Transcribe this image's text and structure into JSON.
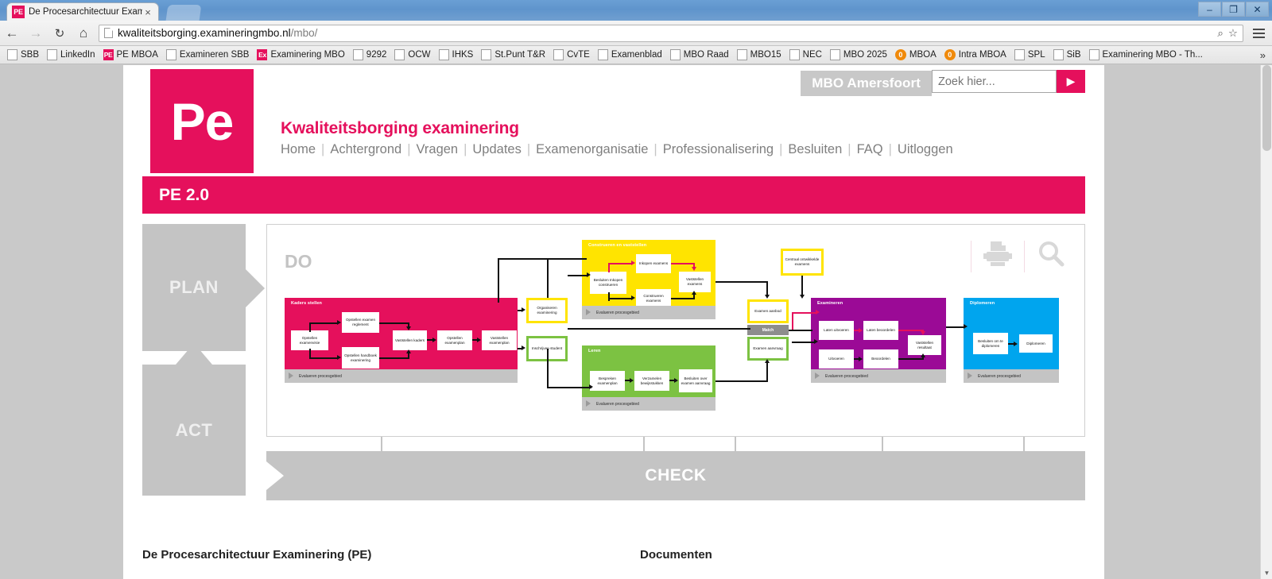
{
  "browser": {
    "tab": {
      "title": "De Procesarchitectuur Exami",
      "favicon_label": "PE",
      "close_label": "×"
    },
    "new_tab_label": "",
    "window_controls": {
      "minimize": "–",
      "maximize": "❐",
      "close": "✕"
    },
    "nav": {
      "back": "←",
      "forward": "→",
      "reload": "↻",
      "home": "⌂"
    },
    "omnibox": {
      "url_host": "kwaliteitsborging.examineringmbo.nl",
      "url_path": "/mbo/",
      "zoom_icon": "⌕",
      "star_icon": "☆"
    },
    "bookmarks": [
      {
        "label": "SBB",
        "icon": "page-icon"
      },
      {
        "label": "LinkedIn",
        "icon": "page-icon"
      },
      {
        "label": "PE MBOA",
        "icon": "pe-icon",
        "icon_text": "PE"
      },
      {
        "label": "Examineren SBB",
        "icon": "page-icon"
      },
      {
        "label": "Examinering MBO",
        "icon": "ex-icon",
        "icon_text": "Ex"
      },
      {
        "label": "9292",
        "icon": "page-icon"
      },
      {
        "label": "OCW",
        "icon": "page-icon"
      },
      {
        "label": "IHKS",
        "icon": "page-icon"
      },
      {
        "label": "St.Punt T&R",
        "icon": "page-icon"
      },
      {
        "label": "CvTE",
        "icon": "page-icon"
      },
      {
        "label": "Examenblad",
        "icon": "page-icon"
      },
      {
        "label": "MBO Raad",
        "icon": "page-icon"
      },
      {
        "label": "MBO15",
        "icon": "page-icon"
      },
      {
        "label": "NEC",
        "icon": "page-icon"
      },
      {
        "label": "MBO 2025",
        "icon": "page-icon"
      },
      {
        "label": "MBOA",
        "icon": "orange-icon",
        "icon_text": "0"
      },
      {
        "label": "Intra MBOA",
        "icon": "orange-icon",
        "icon_text": "0"
      },
      {
        "label": "SPL",
        "icon": "page-icon"
      },
      {
        "label": "SiB",
        "icon": "page-icon"
      },
      {
        "label": "Examinering MBO - Th...",
        "icon": "page-icon"
      }
    ],
    "bookmarks_overflow": "»"
  },
  "site": {
    "logo_text": "Pe",
    "title": "Kwaliteitsborging examinering",
    "nav_items": [
      "Home",
      "Achtergrond",
      "Vragen",
      "Updates",
      "Examenorganisatie",
      "Professionalisering",
      "Besluiten",
      "FAQ",
      "Uitloggen"
    ],
    "nav_separator": "|",
    "organisation": "MBO Amersfoort",
    "search": {
      "placeholder": "Zoek hier...",
      "value": "",
      "submit_label": "▶"
    },
    "banner_title": "PE 2.0"
  },
  "colors": {
    "brand_pink": "#e5105c",
    "gray": "#c4c4c4",
    "yellow": "#ffe400",
    "green": "#7cc242",
    "purple": "#9b0a96",
    "blue": "#00a5ee",
    "match_gray": "#8d8d8d"
  },
  "diagram": {
    "plan_label": "PLAN",
    "act_label": "ACT",
    "do_label": "DO",
    "check_label": "CHECK",
    "icons": {
      "print": "print-icon",
      "search": "search-icon"
    },
    "footer_label": "Evalueren procesgebied",
    "blocks": [
      {
        "id": "kaders",
        "title": "Kaders stellen",
        "color": "#e5105c",
        "nodes": [
          "Opstellen examenvisie",
          "Opstellen examen reglement",
          "Opstellen handboek examinering",
          "Vaststellen kaders",
          "Opstellen examenplan",
          "Vaststellen examenplan"
        ]
      },
      {
        "id": "construeren",
        "title": "Construeren en vaststellen",
        "color": "#ffe400",
        "nodes": [
          "Besluiten Inkopen construeren",
          "Inkopen examens",
          "Construeren examens",
          "Vaststellen examens"
        ]
      },
      {
        "id": "leren",
        "title": "Leren",
        "color": "#7cc242",
        "nodes": [
          "Bespreken examenplan",
          "Verzamelen bewijsstukken",
          "Besluiten over examen aanvraag"
        ]
      },
      {
        "id": "examineren",
        "title": "Examineren",
        "color": "#9b0a96",
        "nodes": [
          "Laten uitvoeren",
          "Laten beoordelen",
          "Uitvoeren",
          "Beoordelen",
          "Vaststellen resultaat"
        ]
      },
      {
        "id": "diplomeren",
        "title": "Diplomeren",
        "color": "#00a5ee",
        "nodes": [
          "Besluiten om te diplomeren",
          "Diplomeren"
        ]
      }
    ],
    "standalone_nodes": [
      {
        "id": "organiseren",
        "label": "Organiseren examinering",
        "border": "#ffe400"
      },
      {
        "id": "inschrijven",
        "label": "Inschrijven student",
        "border": "#7cc242"
      },
      {
        "id": "centraal",
        "label": "Centraal ontwikkelde examens",
        "border": "#ffe400"
      },
      {
        "id": "aanbod",
        "label": "Examen aanbod",
        "border": "#ffe400"
      },
      {
        "id": "aanvraag",
        "label": "Examen aanvraag",
        "border": "#7cc242"
      }
    ],
    "match_label": "Match"
  },
  "bottom": {
    "left_heading": "De Procesarchitectuur Examinering (PE)",
    "right_heading": "Documenten"
  }
}
